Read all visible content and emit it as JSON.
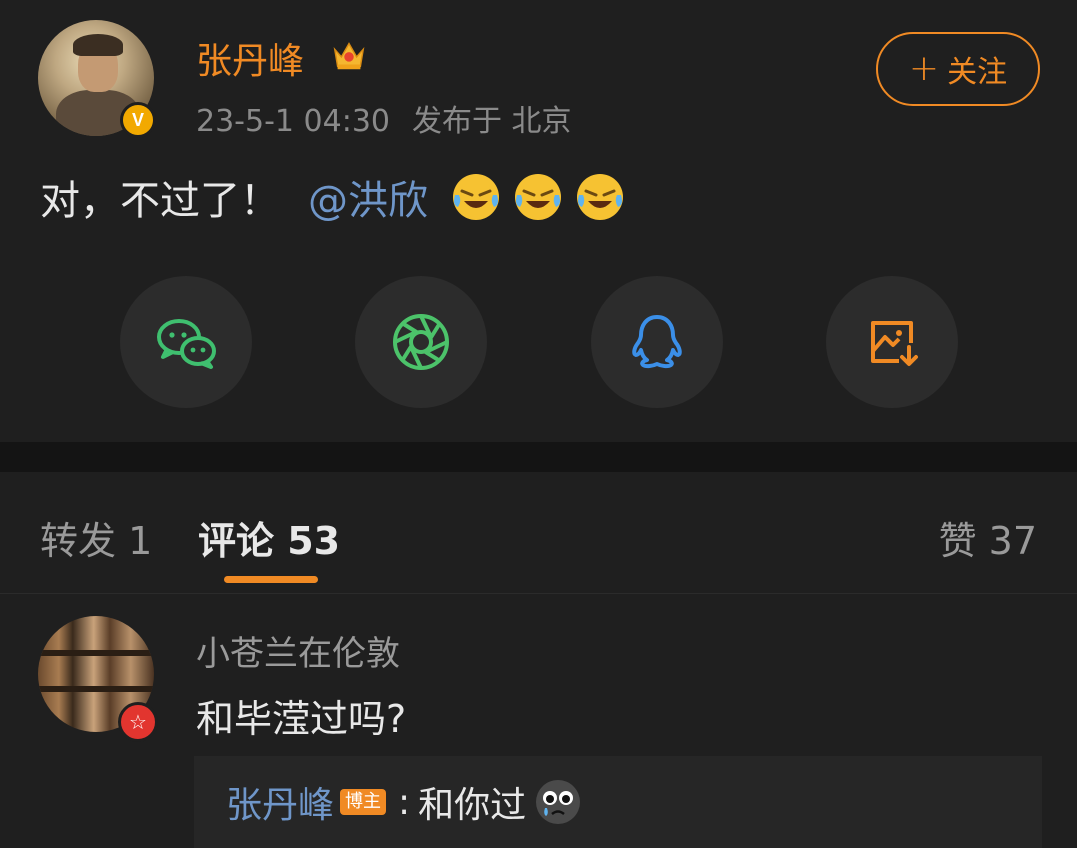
{
  "post": {
    "author": "张丹峰",
    "verified_badge": "V",
    "crown_icon": "crown-icon",
    "timestamp": "23-5-1 04:30",
    "location": "发布于 北京",
    "follow_label": "关注",
    "text": "对，不过了！",
    "mention": "@洪欣",
    "emojis": [
      "laugh-cry-emoji",
      "laugh-cry-emoji",
      "laugh-cry-emoji"
    ]
  },
  "share": {
    "items": [
      {
        "name": "wechat-icon",
        "color": "#3fbf6f"
      },
      {
        "name": "moments-icon",
        "color": "#4cc36a"
      },
      {
        "name": "qq-icon",
        "color": "#3b8fe8"
      },
      {
        "name": "save-image-icon",
        "color": "#f08a24"
      }
    ]
  },
  "tabs": {
    "repost": "转发 1",
    "comments": "评论 53",
    "likes": "赞 37"
  },
  "comment": {
    "user": "小苍兰在伦敦",
    "user_badge": "☆",
    "text": "和毕滢过吗?",
    "reply": {
      "author": "张丹峰",
      "badge": "博主",
      "colon": ":",
      "text": "和你过",
      "emoji": "crying-emoji"
    }
  },
  "colors": {
    "accent": "#f08a24",
    "link": "#6f96c9",
    "background": "#1f1f1f"
  }
}
